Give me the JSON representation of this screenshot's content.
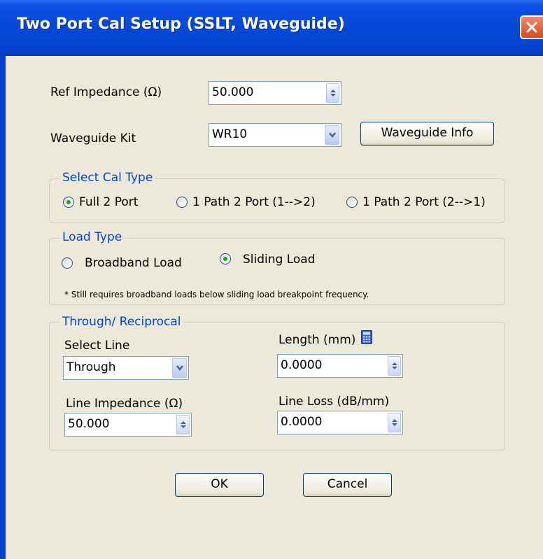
{
  "window": {
    "title": "Two Port Cal Setup (SSLT, Waveguide)",
    "close_icon": "close-icon"
  },
  "ref_impedance": {
    "label": "Ref Impedance (Ω)",
    "value": "50.000"
  },
  "waveguide_kit": {
    "label": "Waveguide  Kit",
    "value": "WR10",
    "info_button": "Waveguide Info"
  },
  "cal_type": {
    "legend": "Select Cal Type",
    "options": [
      "Full 2 Port",
      "1 Path 2 Port (1-->2)",
      "1 Path 2 Port (2-->1)"
    ],
    "selected": "Full 2 Port"
  },
  "load_type": {
    "legend": "Load Type",
    "options": [
      "Broadband Load",
      "Sliding Load"
    ],
    "selected": "Sliding Load",
    "note": "* Still requires broadband loads below sliding load breakpoint frequency."
  },
  "through": {
    "legend": "Through/ Reciprocal",
    "select_line_label": "Select Line",
    "select_line_value": "Through",
    "length_label": "Length (mm)",
    "length_value": "0.0000",
    "line_impedance_label": "Line Impedance (Ω)",
    "line_impedance_value": "50.000",
    "line_loss_label": "Line Loss (dB/mm)",
    "line_loss_value": "0.0000"
  },
  "buttons": {
    "ok": "OK",
    "cancel": "Cancel"
  },
  "colors": {
    "accent": "#0046d5",
    "titlebar": "#0548d8",
    "dialog_bg": "#ece9d8",
    "radio_dot": "#21a121"
  }
}
